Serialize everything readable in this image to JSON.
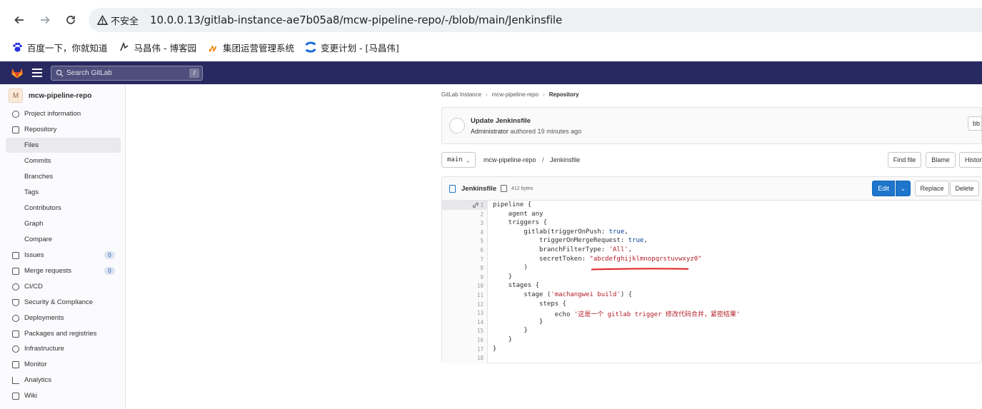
{
  "browser": {
    "security_label": "不安全",
    "url": "10.0.0.13/gitlab-instance-ae7b05a8/mcw-pipeline-repo/-/blob/main/Jenkinsfile",
    "bookmarks": [
      {
        "label": "百度一下，你就知道",
        "icon": "baidu-paw-icon"
      },
      {
        "label": "马昌伟 - 博客园",
        "icon": "cnblogs-icon"
      },
      {
        "label": "集团运营管理系统",
        "icon": "fire-icon"
      },
      {
        "label": "变更计划 - [马昌伟]",
        "icon": "confluence-icon"
      }
    ]
  },
  "gitlab_header": {
    "search_placeholder": "Search GitLab",
    "search_shortcut": "/",
    "accent": "#292961"
  },
  "sidebar": {
    "project_initial": "M",
    "project_name": "mcw-pipeline-repo",
    "items": [
      {
        "label": "Project information",
        "icon": "info-icon"
      },
      {
        "label": "Repository",
        "icon": "doc-icon"
      },
      {
        "label": "Files",
        "sub": true,
        "active": true
      },
      {
        "label": "Commits",
        "sub": true
      },
      {
        "label": "Branches",
        "sub": true
      },
      {
        "label": "Tags",
        "sub": true
      },
      {
        "label": "Contributors",
        "sub": true
      },
      {
        "label": "Graph",
        "sub": true
      },
      {
        "label": "Compare",
        "sub": true
      },
      {
        "label": "Issues",
        "icon": "issues-icon",
        "badge": "0"
      },
      {
        "label": "Merge requests",
        "icon": "merge-request-icon",
        "badge": "0"
      },
      {
        "label": "CI/CD",
        "icon": "rocket-icon"
      },
      {
        "label": "Security & Compliance",
        "icon": "shield-icon"
      },
      {
        "label": "Deployments",
        "icon": "deploy-icon"
      },
      {
        "label": "Packages and registries",
        "icon": "package-icon"
      },
      {
        "label": "Infrastructure",
        "icon": "cloud-icon"
      },
      {
        "label": "Monitor",
        "icon": "monitor-icon"
      },
      {
        "label": "Analytics",
        "icon": "chart-icon"
      },
      {
        "label": "Wiki",
        "icon": "book-icon"
      }
    ]
  },
  "breadcrumb": [
    "GitLab Instance",
    "mcw-pipeline-repo",
    "Repository"
  ],
  "commit": {
    "title": "Update Jenkinsfile",
    "author": "Administrator",
    "meta_rest": "authored 19 minutes ago",
    "sha_prefix": "bb"
  },
  "file_nav": {
    "branch": "main",
    "path_repo": "mcw-pipeline-repo",
    "path_sep": "/",
    "path_file": "Jenkinsfile",
    "buttons": [
      "Find file",
      "Blame",
      "History"
    ]
  },
  "file": {
    "name": "Jenkinsfile",
    "size": "412 bytes",
    "actions": {
      "edit": "Edit",
      "replace": "Replace",
      "delete": "Delete"
    },
    "lines": [
      "pipeline {",
      "    agent any",
      "    triggers {",
      "        gitlab(triggerOnPush: true,",
      "            triggerOnMergeRequest: true,",
      "            branchFilterType: 'All',",
      "            secretToken: \"abcdefghijklmnopqrstuvwxyz0\"",
      "        )",
      "    }",
      "    stages {",
      "        stage ('machangwei build') {",
      "            steps {",
      "                echo '这是一个 gitlab trigger 修改代码合并，紧密结果'",
      "            }",
      "        }",
      "    }",
      "}",
      ""
    ]
  }
}
